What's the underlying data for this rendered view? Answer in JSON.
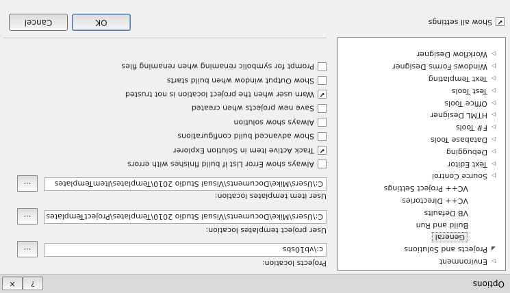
{
  "window": {
    "title": "Options",
    "help_button": "?",
    "close_button": "✕"
  },
  "tree": {
    "items": [
      {
        "label": "Environment",
        "arrow": "▷",
        "indent": 0
      },
      {
        "label": "Projects and Solutions",
        "arrow": "◢",
        "indent": 0
      },
      {
        "label": "General",
        "arrow": "",
        "indent": 1,
        "selected": true
      },
      {
        "label": "Build and Run",
        "arrow": "",
        "indent": 1
      },
      {
        "label": "VB Defaults",
        "arrow": "",
        "indent": 1
      },
      {
        "label": "VC++ Directories",
        "arrow": "",
        "indent": 1
      },
      {
        "label": "VC++ Project Settings",
        "arrow": "",
        "indent": 1
      },
      {
        "label": "Source Control",
        "arrow": "▷",
        "indent": 0
      },
      {
        "label": "Text Editor",
        "arrow": "▷",
        "indent": 0
      },
      {
        "label": "Debugging",
        "arrow": "▷",
        "indent": 0
      },
      {
        "label": "Database Tools",
        "arrow": "▷",
        "indent": 0
      },
      {
        "label": "F# Tools",
        "arrow": "▷",
        "indent": 0
      },
      {
        "label": "HTML Designer",
        "arrow": "▷",
        "indent": 0
      },
      {
        "label": "Office Tools",
        "arrow": "▷",
        "indent": 0
      },
      {
        "label": "Test Tools",
        "arrow": "▷",
        "indent": 0
      },
      {
        "label": "Text Templating",
        "arrow": "▷",
        "indent": 0
      },
      {
        "label": "Windows Forms Designer",
        "arrow": "▷",
        "indent": 0
      },
      {
        "label": "Workflow Designer",
        "arrow": "▷",
        "indent": 0
      }
    ]
  },
  "locations": {
    "projects_label": "Projects location:",
    "projects_value": "c:\\vb10sbs",
    "project_templates_label": "User project templates location:",
    "project_templates_value": "C:\\Users\\Mike\\Documents\\Visual Studio 2010\\Templates\\ProjectTemplates",
    "item_templates_label": "User item templates location:",
    "item_templates_value": "C:\\Users\\Mike\\Documents\\Visual Studio 2010\\Templates\\ItemTemplates",
    "browse_label": "..."
  },
  "options": [
    {
      "label": "Always show Error List if build finishes with errors",
      "checked": false
    },
    {
      "label": "Track Active Item in Solution Explorer",
      "checked": true
    },
    {
      "label": "Show advanced build configurations",
      "checked": false
    },
    {
      "label": "Always show solution",
      "checked": false
    },
    {
      "label": "Save new projects when created",
      "checked": false
    },
    {
      "label": "Warn user when the project location is not trusted",
      "checked": true
    },
    {
      "label": "Show Output window when build starts",
      "checked": false
    },
    {
      "label": "Prompt for symbolic renaming when renaming files",
      "checked": false
    }
  ],
  "footer": {
    "show_all_settings": "Show all settings",
    "show_all_checked": true,
    "ok": "OK",
    "cancel": "Cancel"
  }
}
